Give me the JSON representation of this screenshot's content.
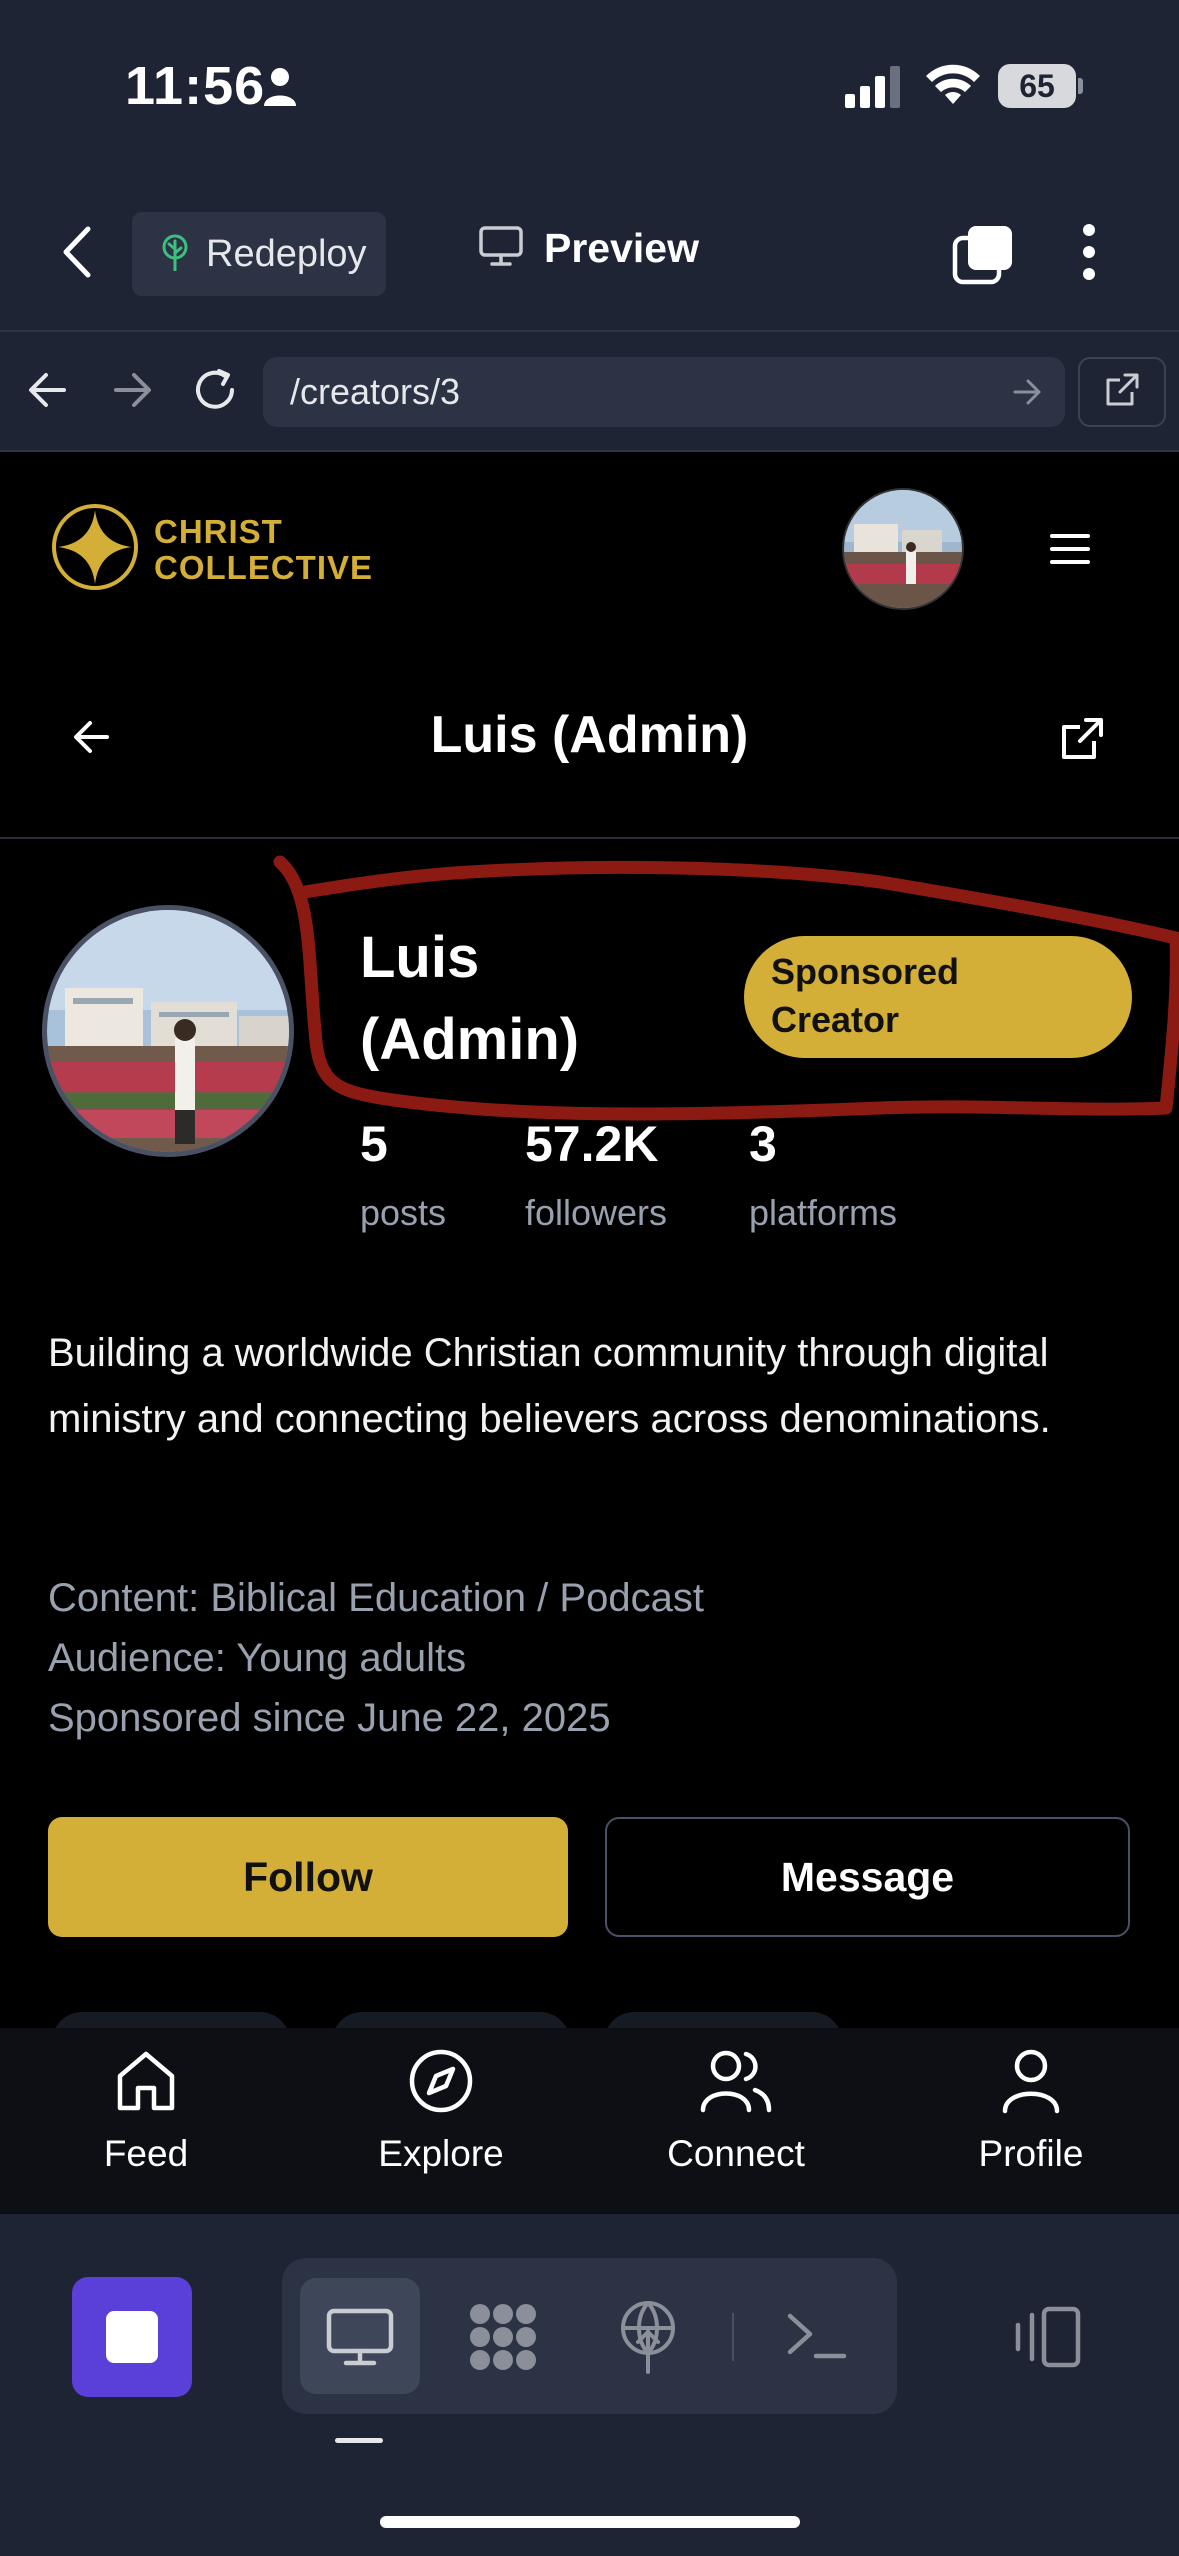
{
  "status_bar": {
    "time": "11:56",
    "battery": "65"
  },
  "app_bar": {
    "redeploy_label": "Redeploy",
    "preview_label": "Preview"
  },
  "url_bar": {
    "url": "/creators/3"
  },
  "site": {
    "logo_line1": "CHRIST",
    "logo_line2": "COLLECTIVE"
  },
  "profile": {
    "page_title": "Luis (Admin)",
    "name_line1": "Luis",
    "name_line2": "(Admin)",
    "badge_line1": "Sponsored",
    "badge_line2": "Creator",
    "stats": [
      {
        "value": "5",
        "label": "posts"
      },
      {
        "value": "57.2K",
        "label": "followers"
      },
      {
        "value": "3",
        "label": "platforms"
      }
    ],
    "bio": "Building a worldwide Christian community through digital ministry and connecting believers across denominations.",
    "content": "Content: Biblical Education / Podcast",
    "audience": "Audience: Young adults",
    "sponsored_since": "Sponsored since June 22, 2025",
    "follow_label": "Follow",
    "message_label": "Message"
  },
  "bottom_nav": [
    {
      "label": "Feed",
      "icon": "home-icon"
    },
    {
      "label": "Explore",
      "icon": "compass-icon"
    },
    {
      "label": "Connect",
      "icon": "users-icon"
    },
    {
      "label": "Profile",
      "icon": "user-icon"
    }
  ],
  "colors": {
    "brand_gold": "#d4af37",
    "chrome_bg": "#1e2433",
    "stop_purple": "#5b3fd9",
    "annotation_red": "#8b1a12"
  }
}
